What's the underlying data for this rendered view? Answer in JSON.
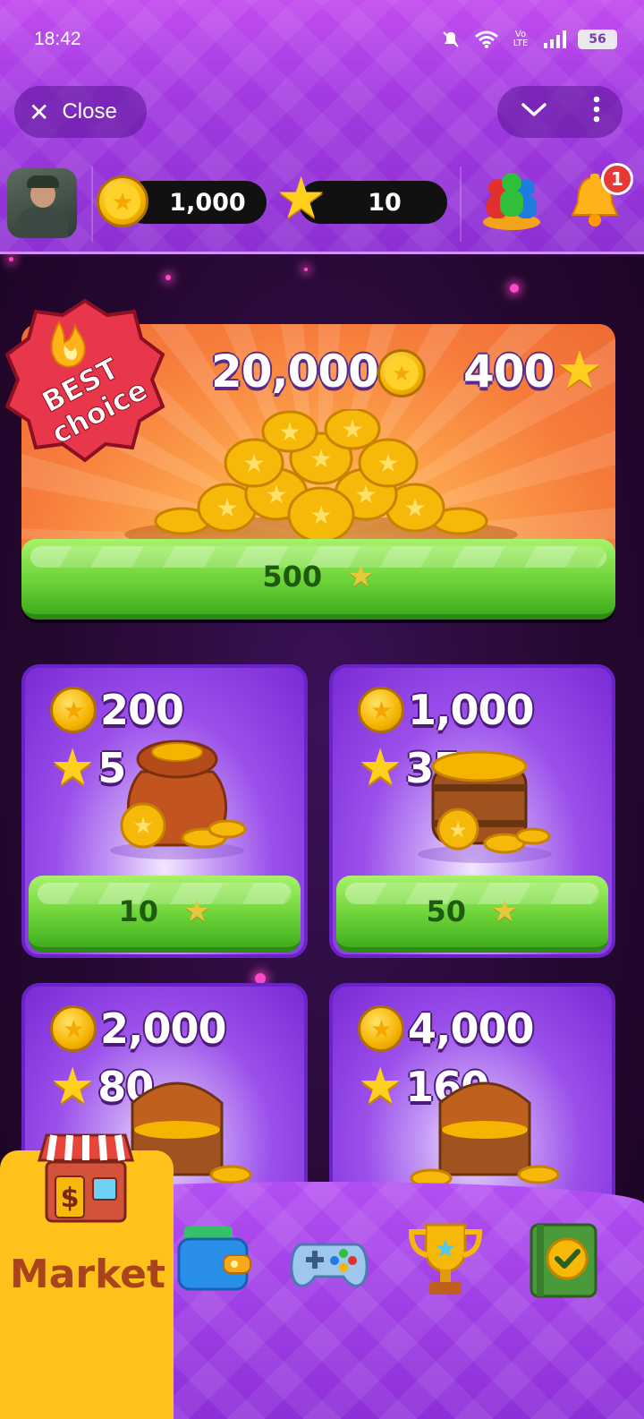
{
  "status_bar": {
    "time": "18:42",
    "battery": "56",
    "network_label": "Vo LTE"
  },
  "header": {
    "close_label": "Close",
    "coins": "1,000",
    "stars": "10",
    "notification_count": "1"
  },
  "best_offer": {
    "badge_line1": "BEST",
    "badge_line2": "choice",
    "coins": "20,000",
    "stars": "400",
    "price": "500"
  },
  "packs": [
    {
      "coins": "200",
      "stars": "5",
      "price": "10",
      "art": "coin-bag-icon"
    },
    {
      "coins": "1,000",
      "stars": "35",
      "price": "50",
      "art": "coin-barrel-icon"
    },
    {
      "coins": "2,000",
      "stars": "80",
      "art": "treasure-chest-icon"
    },
    {
      "coins": "4,000",
      "stars": "160",
      "art": "treasure-chest-icon"
    }
  ],
  "bottom_nav": {
    "active_label": "Market",
    "items": [
      "market-icon",
      "wallet-icon",
      "gamepad-icon",
      "trophy-icon",
      "task-book-icon"
    ]
  },
  "colors": {
    "accent_purple": "#a23ae0",
    "buy_green": "#6ed339",
    "market_yellow": "#ffc21a",
    "coin_gold": "#f5b400"
  }
}
